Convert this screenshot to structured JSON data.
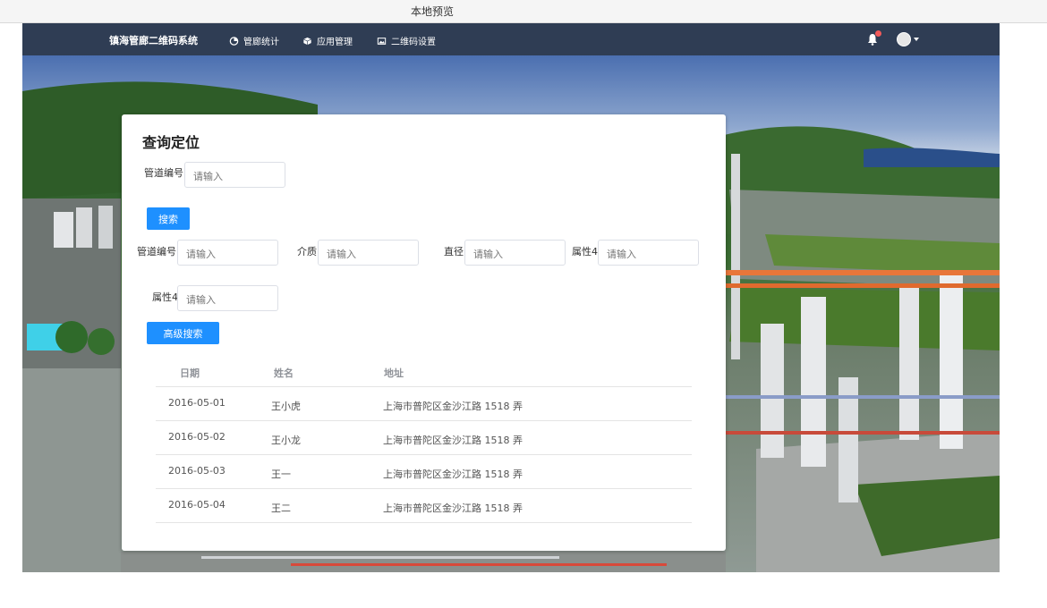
{
  "preview": {
    "title": "本地预览"
  },
  "nav": {
    "brand": "镇海管廊二维码系统",
    "items": [
      {
        "label": "管廊统计",
        "icon": "pie-chart-icon"
      },
      {
        "label": "应用管理",
        "icon": "cube-icon"
      },
      {
        "label": "二维码设置",
        "icon": "image-icon"
      }
    ],
    "notification_icon": "bell-icon",
    "notification_color": "#f15a5a",
    "avatar_icon": "user-avatar-icon"
  },
  "panel": {
    "title": "查询定位",
    "basic_search": {
      "field_label": "管道编号",
      "placeholder": "请输入",
      "button_label": "搜索"
    },
    "advanced_search": {
      "fields": [
        {
          "label": "管道编号",
          "placeholder": "请输入"
        },
        {
          "label": "介质",
          "placeholder": "请输入"
        },
        {
          "label": "直径",
          "placeholder": "请输入"
        },
        {
          "label": "属性4",
          "placeholder": "请输入"
        },
        {
          "label": "属性4",
          "placeholder": "请输入"
        }
      ],
      "button_label": "高级搜索"
    },
    "table": {
      "columns": [
        "日期",
        "姓名",
        "地址"
      ],
      "rows": [
        {
          "date": "2016-05-01",
          "name": "王小虎",
          "address": "上海市普陀区金沙江路 1518 弄"
        },
        {
          "date": "2016-05-02",
          "name": "王小龙",
          "address": "上海市普陀区金沙江路 1518 弄"
        },
        {
          "date": "2016-05-03",
          "name": "王一",
          "address": "上海市普陀区金沙江路 1518 弄"
        },
        {
          "date": "2016-05-04",
          "name": "王二",
          "address": "上海市普陀区金沙江路 1518 弄"
        }
      ]
    }
  },
  "colors": {
    "nav_bg": "#2f3d54",
    "primary": "#1e90ff"
  }
}
